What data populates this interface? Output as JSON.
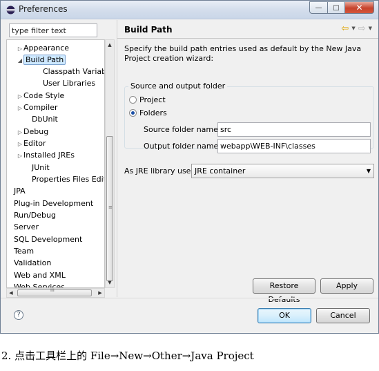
{
  "window": {
    "title": "Preferences",
    "minimize_glyph": "—",
    "maximize_glyph": "□",
    "close_glyph": "✕"
  },
  "filter": {
    "placeholder": "type filter text"
  },
  "tree": {
    "items": [
      {
        "label": "Appearance",
        "expander": "▷"
      },
      {
        "label": "Build Path",
        "expander": "◢"
      },
      {
        "label": "Classpath Variables",
        "expander": ""
      },
      {
        "label": "User Libraries",
        "expander": ""
      },
      {
        "label": "Code Style",
        "expander": "▷"
      },
      {
        "label": "Compiler",
        "expander": "▷"
      },
      {
        "label": "DbUnit",
        "expander": ""
      },
      {
        "label": "Debug",
        "expander": "▷"
      },
      {
        "label": "Editor",
        "expander": "▷"
      },
      {
        "label": "Installed JREs",
        "expander": "▷"
      },
      {
        "label": "JUnit",
        "expander": ""
      },
      {
        "label": "Properties Files Editor",
        "expander": ""
      },
      {
        "label": "JPA",
        "expander": ""
      },
      {
        "label": "Plug-in Development",
        "expander": ""
      },
      {
        "label": "Run/Debug",
        "expander": ""
      },
      {
        "label": "Server",
        "expander": ""
      },
      {
        "label": "SQL Development",
        "expander": ""
      },
      {
        "label": "Team",
        "expander": ""
      },
      {
        "label": "Validation",
        "expander": ""
      },
      {
        "label": "Web and XML",
        "expander": ""
      },
      {
        "label": "Web Services",
        "expander": ""
      }
    ],
    "selected_index": 1
  },
  "page": {
    "title": "Build Path",
    "description": "Specify the build path entries used as default by the New Java Project creation wizard:",
    "group_label": "Source and output folder",
    "radio_project": "Project",
    "radio_folders": "Folders",
    "selected_radio": "Folders",
    "source_label": "Source folder name:",
    "source_value": "src",
    "output_label": "Output folder name:",
    "output_value": "webapp\\WEB-INF\\classes",
    "jre_label": "As JRE library use:",
    "jre_value": "JRE container",
    "restore_defaults": "Restore Defaults",
    "apply": "Apply"
  },
  "footer": {
    "help_glyph": "?",
    "ok": "OK",
    "cancel": "Cancel"
  },
  "caption": "2.  点击工具栏上的 File→New→Other→Java Project",
  "colors": {
    "selection_bg": "#cde8ff",
    "close_button": "#c7422c",
    "nav_back_arrow": "#e0a400"
  }
}
